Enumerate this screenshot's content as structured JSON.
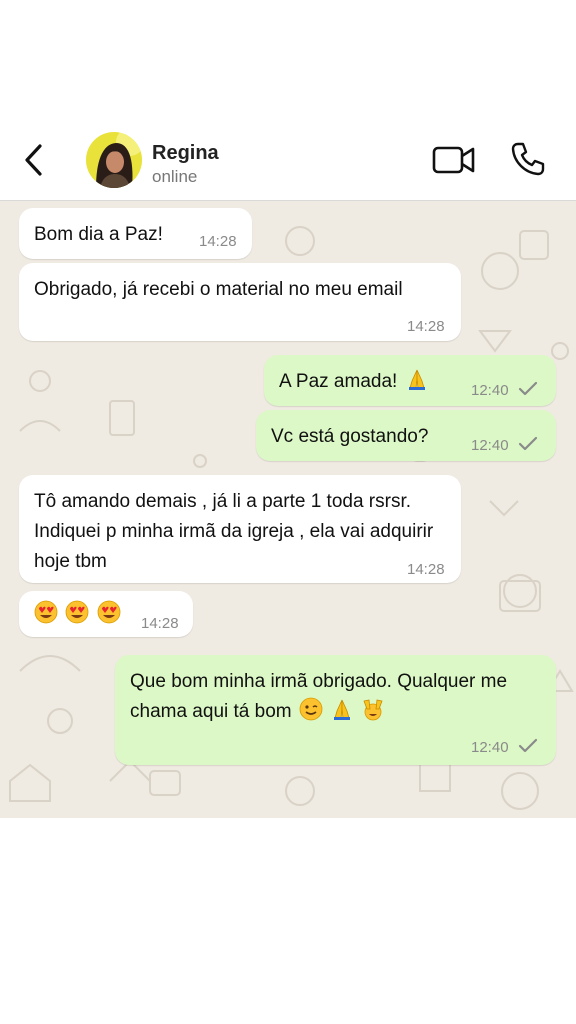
{
  "header": {
    "back_icon": "chevron-left-icon",
    "contact_name": "Regina",
    "status": "online",
    "video_icon": "video-camera-icon",
    "call_icon": "phone-icon"
  },
  "colors": {
    "incoming_bubble": "#ffffff",
    "outgoing_bubble": "#dcf8c6",
    "chat_background": "#efeae2",
    "timestamp": "#8a8a8a"
  },
  "messages": [
    {
      "direction": "in",
      "text": "Bom dia a Paz!",
      "time": "14:28"
    },
    {
      "direction": "in",
      "text": "Obrigado, já recebi o material no meu email",
      "time": "14:28"
    },
    {
      "direction": "out",
      "text": "A Paz amada!",
      "emojis": [
        "folded-hands"
      ],
      "time": "12:40",
      "status": "sent-check"
    },
    {
      "direction": "out",
      "text": "Vc está gostando?",
      "time": "12:40",
      "status": "sent-check"
    },
    {
      "direction": "in",
      "text": "Tô amando demais , já li a parte 1 toda rsrsr. Indiquei p minha irmã da igreja , ela vai adquirir hoje tbm",
      "time": "14:28"
    },
    {
      "direction": "in",
      "text": "",
      "emojis": [
        "heart-eyes",
        "heart-eyes",
        "heart-eyes"
      ],
      "time": "14:28"
    },
    {
      "direction": "out",
      "text": "Que bom minha irmã obrigado. Qualquer me chama aqui tá bom",
      "emojis": [
        "winking-face",
        "folded-hands",
        "raising-hands"
      ],
      "time": "12:40",
      "status": "sent-check"
    }
  ]
}
